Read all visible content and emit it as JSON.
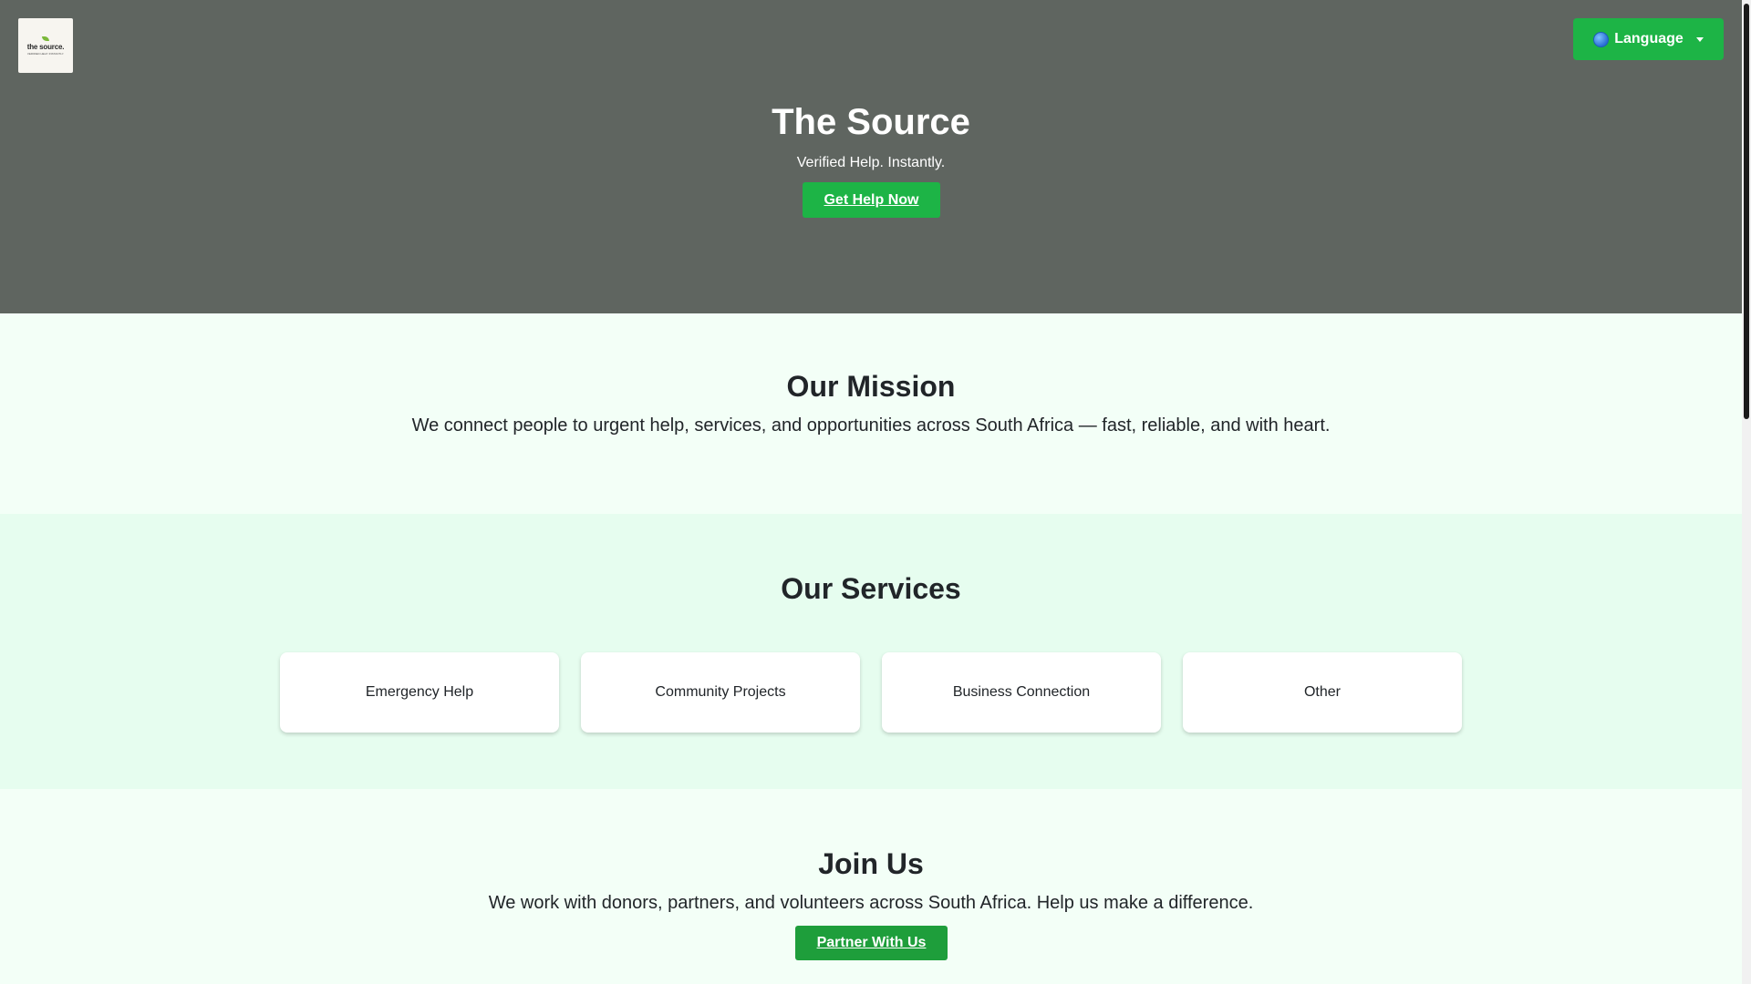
{
  "header": {
    "logo": {
      "brand": "the source.",
      "tagline": "VERIFIED HELP. INSTANTLY."
    },
    "language_button": {
      "label": "Language",
      "icon": "globe-icon"
    }
  },
  "hero": {
    "title": "The Source",
    "subtitle": "Verified Help. Instantly.",
    "cta_label": "Get Help Now"
  },
  "mission": {
    "title": "Our Mission",
    "text": "We connect people to urgent help, services, and opportunities across South Africa — fast, reliable, and with heart."
  },
  "services": {
    "title": "Our Services",
    "items": [
      {
        "label": "Emergency Help"
      },
      {
        "label": "Community Projects"
      },
      {
        "label": "Business Connection"
      },
      {
        "label": "Other"
      }
    ]
  },
  "join": {
    "title": "Join Us",
    "text": "We work with donors, partners, and volunteers across South Africa. Help us make a difference.",
    "cta_label": "Partner With Us"
  },
  "colors": {
    "accent_green": "#1db446",
    "hero_bg": "#5f6560",
    "services_bg": "#e6fdef",
    "page_bg": "#f3fff7"
  }
}
